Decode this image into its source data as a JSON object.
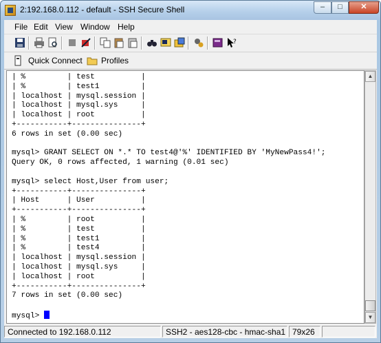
{
  "window": {
    "title": "2:192.168.0.112 - default - SSH Secure Shell",
    "controls": {
      "minimize": "–",
      "maximize": "□",
      "close": "✕"
    }
  },
  "menu": [
    "File",
    "Edit",
    "View",
    "Window",
    "Help"
  ],
  "toolbar": {
    "icons": [
      "save-icon",
      "print-icon",
      "print-preview-icon",
      "connect-icon",
      "disconnect-icon",
      "copy-icon",
      "paste-icon",
      "paste-alt-icon",
      "find-icon",
      "new-terminal-icon",
      "new-file-transfer-icon",
      "settings-icon",
      "help-book-icon",
      "context-help-icon"
    ]
  },
  "profilebar": {
    "quick_connect": "Quick Connect",
    "profiles": "Profiles"
  },
  "terminal": {
    "lines": [
      "| %         | test          |",
      "| %         | test1         |",
      "| localhost | mysql.session |",
      "| localhost | mysql.sys     |",
      "| localhost | root          |",
      "+-----------+---------------+",
      "6 rows in set (0.00 sec)",
      "",
      "mysql> GRANT SELECT ON *.* TO test4@'%' IDENTIFIED BY 'MyNewPass4!';",
      "Query OK, 0 rows affected, 1 warning (0.01 sec)",
      "",
      "mysql> select Host,User from user;",
      "+-----------+---------------+",
      "| Host      | User          |",
      "+-----------+---------------+",
      "| %         | root          |",
      "| %         | test          |",
      "| %         | test1         |",
      "| %         | test4         |",
      "| localhost | mysql.session |",
      "| localhost | mysql.sys     |",
      "| localhost | root          |",
      "+-----------+---------------+",
      "7 rows in set (0.00 sec)",
      ""
    ],
    "prompt": "mysql> ",
    "cursor_color": "#0000ff"
  },
  "status": {
    "connection": "Connected to 192.168.0.112",
    "protocol": "SSH2 - aes128-cbc - hmac-sha1",
    "size": "79x26"
  },
  "colors": {
    "title_gradient": "#b6d0ea",
    "terminal_bg": "#ffffff",
    "terminal_fg": "#000000"
  }
}
